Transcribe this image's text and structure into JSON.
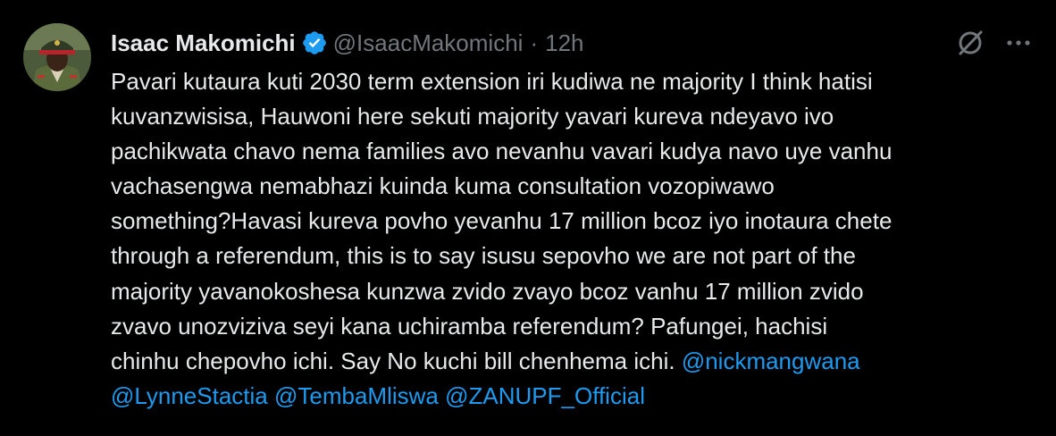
{
  "author": {
    "display_name": "Isaac Makomichi",
    "handle": "@IsaacMakomichi",
    "separator": "·",
    "time": "12h",
    "verified": true,
    "verified_color": "#1d9bf0"
  },
  "tweet": {
    "lines": [
      "Pavari kutaura kuti 2030 term extension iri kudiwa ne majority I think hatisi",
      "kuvanzwisisa, Hauwoni here sekuti majority yavari kureva ndeyavo ivo",
      "pachikwata chavo nema families avo nevanhu vavari kudya navo uye vanhu",
      "vachasengwa nemabhazi kuinda kuma consultation vozopiwawo",
      "something?Havasi kureva povho yevanhu 17 million bcoz iyo inotaura chete",
      "through a referendum, this is to say isusu sepovho we are not part of the",
      "majority yavanokoshesa kunzwa zvido zvayo bcoz vanhu 17 million zvido",
      "zvavo unozviziva seyi kana uchiramba referendum? Pafungei, hachisi"
    ],
    "line9_text": "chinhu chepovho ichi. Say No kuchi bill chenhema ichi. ",
    "mentions": [
      "@nickmangwana",
      "@LynneStactia",
      "@TembaMliswa",
      "@ZANUPF_Official"
    ]
  },
  "icons": {
    "grok": "grok-icon",
    "more": "more-icon",
    "verified": "verified-badge-icon"
  },
  "colors": {
    "background": "#000000",
    "text": "#e7e9ea",
    "muted": "#71767b",
    "link": "#1d9bf0"
  }
}
